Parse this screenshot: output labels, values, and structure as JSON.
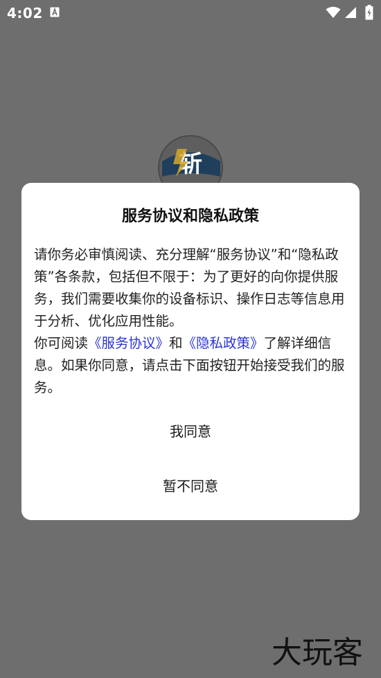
{
  "status_bar": {
    "time": "4:02",
    "notification_icon": "app-notification-icon",
    "wifi_icon": "wifi-icon",
    "signal_icon": "signal-icon",
    "battery_icon": "battery-charging-icon"
  },
  "background": {
    "logo_icon": "app-logo-icon"
  },
  "dialog": {
    "title": "服务协议和隐私政策",
    "paragraph1": "请你务必审慎阅读、充分理解“服务协议”和“隐私政策”各条款，包括但不限于：为了更好的向你提供服务，我们需要收集你的设备标识、操作日志等信息用于分析、优化应用性能。",
    "paragraph2": {
      "prefix": "你可阅读",
      "link_service": "《服务协议》",
      "middle": "和",
      "link_privacy": "《隐私政策》",
      "suffix": "了解详细信息。如果你同意，请点击下面按钮开始接受我们的服务。"
    },
    "agree_label": "我同意",
    "disagree_label": "暂不同意"
  },
  "colors": {
    "overlay": "#6e6e6e",
    "dialog_bg": "#ffffff",
    "link": "#2a34d4"
  },
  "watermark": {
    "text": "大玩客"
  }
}
